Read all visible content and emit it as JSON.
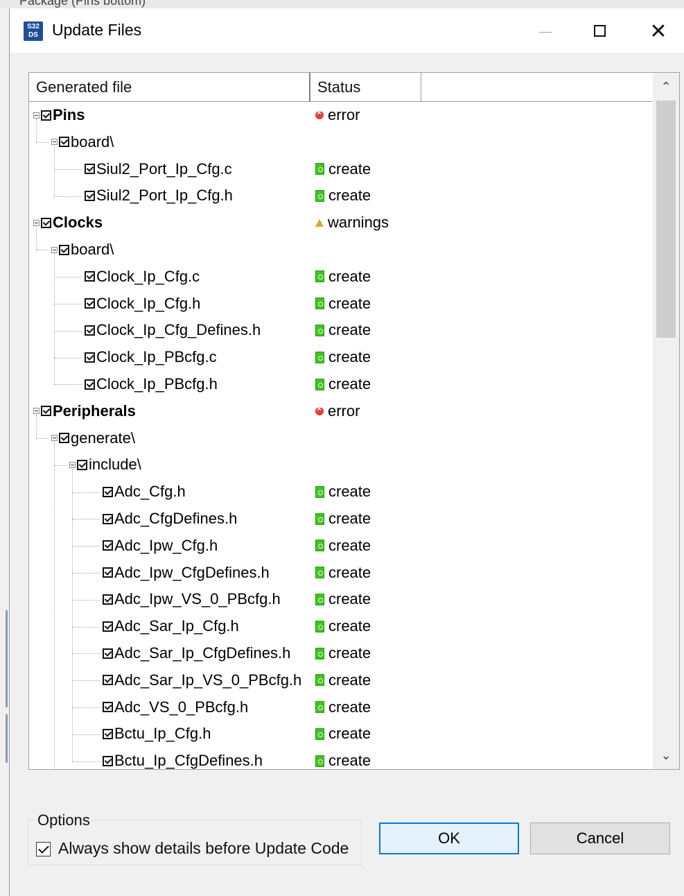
{
  "background": {
    "window_text": "Package (Pins bottom)"
  },
  "title_bar": {
    "icon_text_top": "S32",
    "icon_text_bottom": "DS",
    "title": "Update Files",
    "minimize": "—",
    "maximize": "☐",
    "close": "✕"
  },
  "table": {
    "headers": {
      "file": "Generated file",
      "status": "Status"
    },
    "rows": [
      {
        "level": 0,
        "name": "Pins",
        "status": "error",
        "expanded": true,
        "bold": true
      },
      {
        "level": 1,
        "name": "board\\",
        "status": "",
        "expanded": true,
        "bold": false
      },
      {
        "level": 2,
        "name": "Siul2_Port_Ip_Cfg.c",
        "status": "create",
        "bold": false
      },
      {
        "level": 2,
        "name": "Siul2_Port_Ip_Cfg.h",
        "status": "create",
        "bold": false
      },
      {
        "level": 0,
        "name": "Clocks",
        "status": "warnings",
        "expanded": true,
        "bold": true
      },
      {
        "level": 1,
        "name": "board\\",
        "status": "",
        "expanded": true,
        "bold": false
      },
      {
        "level": 2,
        "name": "Clock_Ip_Cfg.c",
        "status": "create",
        "bold": false
      },
      {
        "level": 2,
        "name": "Clock_Ip_Cfg.h",
        "status": "create",
        "bold": false
      },
      {
        "level": 2,
        "name": "Clock_Ip_Cfg_Defines.h",
        "status": "create",
        "bold": false
      },
      {
        "level": 2,
        "name": "Clock_Ip_PBcfg.c",
        "status": "create",
        "bold": false
      },
      {
        "level": 2,
        "name": "Clock_Ip_PBcfg.h",
        "status": "create",
        "bold": false
      },
      {
        "level": 0,
        "name": "Peripherals",
        "status": "error",
        "expanded": true,
        "bold": true
      },
      {
        "level": 1,
        "name": "generate\\",
        "status": "",
        "expanded": true,
        "bold": false
      },
      {
        "level": 2,
        "name": "include\\",
        "status": "",
        "expanded": true,
        "bold": false
      },
      {
        "level": 3,
        "name": "Adc_Cfg.h",
        "status": "create",
        "bold": false
      },
      {
        "level": 3,
        "name": "Adc_CfgDefines.h",
        "status": "create",
        "bold": false
      },
      {
        "level": 3,
        "name": "Adc_Ipw_Cfg.h",
        "status": "create",
        "bold": false
      },
      {
        "level": 3,
        "name": "Adc_Ipw_CfgDefines.h",
        "status": "create",
        "bold": false
      },
      {
        "level": 3,
        "name": "Adc_Ipw_VS_0_PBcfg.h",
        "status": "create",
        "bold": false
      },
      {
        "level": 3,
        "name": "Adc_Sar_Ip_Cfg.h",
        "status": "create",
        "bold": false
      },
      {
        "level": 3,
        "name": "Adc_Sar_Ip_CfgDefines.h",
        "status": "create",
        "bold": false
      },
      {
        "level": 3,
        "name": "Adc_Sar_Ip_VS_0_PBcfg.h",
        "status": "create",
        "bold": false
      },
      {
        "level": 3,
        "name": "Adc_VS_0_PBcfg.h",
        "status": "create",
        "bold": false
      },
      {
        "level": 3,
        "name": "Bctu_Ip_Cfg.h",
        "status": "create",
        "bold": false
      },
      {
        "level": 3,
        "name": "Bctu_Ip_CfgDefines.h",
        "status": "create",
        "bold": false
      }
    ],
    "status_icons": {
      "create": "create-file-icon",
      "error": "error-icon",
      "warnings": "warning-icon"
    },
    "scroll_position": 0.0,
    "visible_fraction": 0.37
  },
  "options": {
    "group_label": "Options",
    "always_show_label": "Always show details before Update Code",
    "always_show_checked": true
  },
  "buttons": {
    "ok": "OK",
    "cancel": "Cancel"
  },
  "colors": {
    "create_icon": "#3ec51e",
    "error_icon": "#e0403a",
    "warning_icon": "#e0a52a",
    "ok_border": "#0a78d7"
  }
}
